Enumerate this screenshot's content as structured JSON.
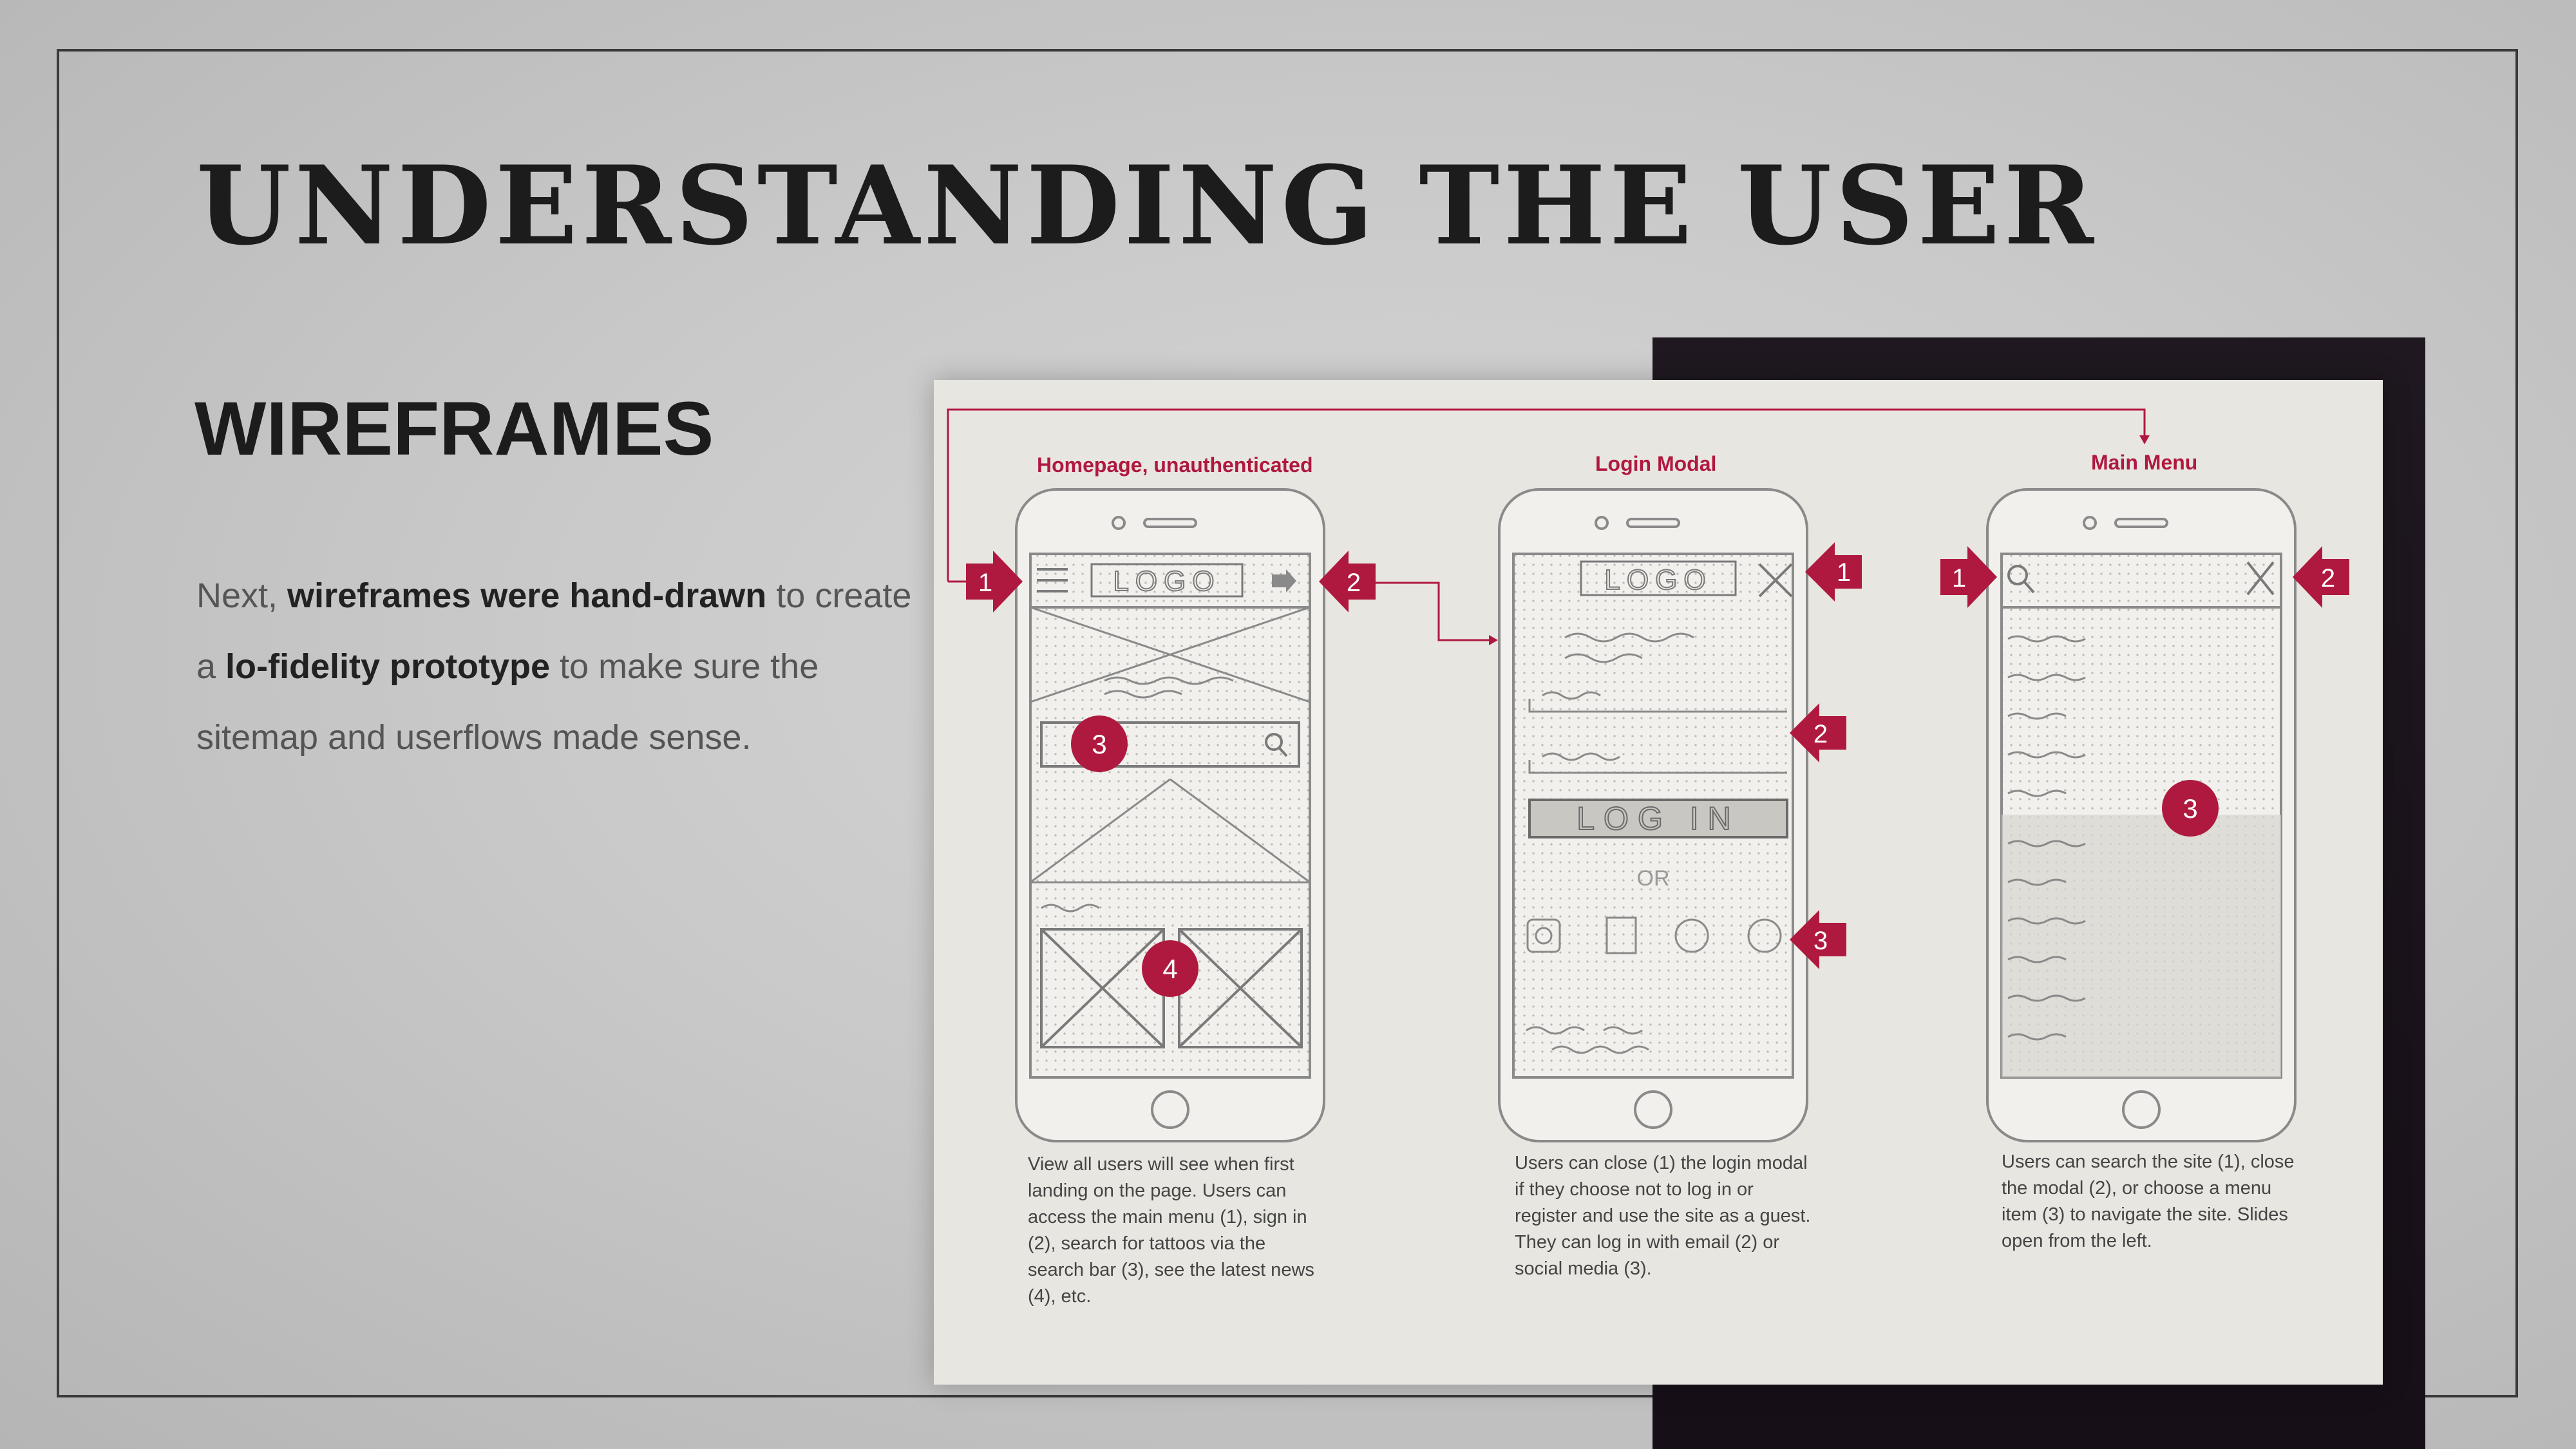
{
  "slide": {
    "title": "UNDERSTANDING THE USER",
    "subtitle": "WIREFRAMES",
    "body": {
      "p1_prefix": "Next, ",
      "p1_bold": "wireframes were hand-drawn",
      "p1_mid": " to create a ",
      "p2_bold": "lo-fidelity prototype",
      "p2_suffix": " to make sure the sitemap and userflows made sense."
    }
  },
  "wireframes": {
    "accent_color": "#b0193f",
    "panels": [
      {
        "title": "Homepage, unauthenticated",
        "caption": "View all users will see when first landing on the page. Users can access the main menu (1), sign in (2), search for tattoos via the search bar (3), see the latest news (4), etc.",
        "sketch_text": {
          "logo": "LOGO"
        },
        "markers": [
          "1",
          "2",
          "3",
          "4"
        ]
      },
      {
        "title": "Login Modal",
        "caption": "Users can close (1) the login modal if they choose not to log in or register and use the site as a guest. They can log in with email (2) or social media (3).",
        "sketch_text": {
          "logo": "LOGO",
          "button": "LOG IN",
          "or": "OR"
        },
        "markers": [
          "1",
          "2",
          "3"
        ]
      },
      {
        "title": "Main Menu",
        "caption": "Users can search the site (1), close the modal (2), or choose a menu item (3) to navigate the site. Slides open from the left.",
        "sketch_text": {},
        "markers": [
          "1",
          "2",
          "3"
        ]
      }
    ]
  }
}
